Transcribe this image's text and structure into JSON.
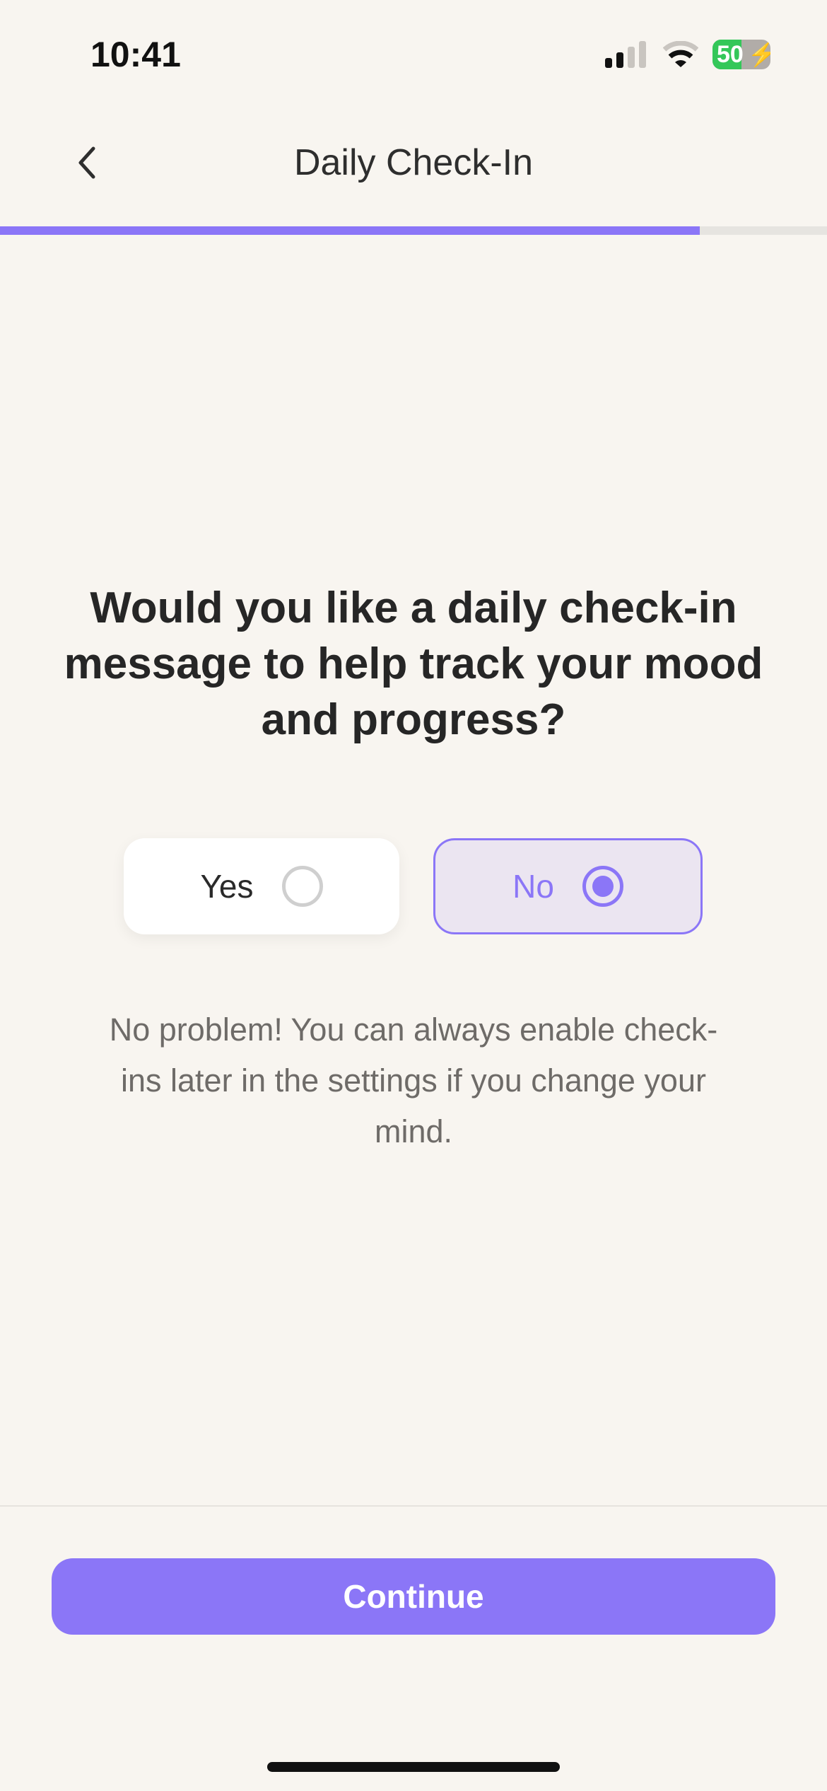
{
  "status_bar": {
    "time": "10:41",
    "battery": "50",
    "battery_level": 0.5,
    "battery_color": "#34c759"
  },
  "header": {
    "title": "Daily Check-In",
    "back_icon": "chevron-left-icon"
  },
  "progress": {
    "value": 0.846,
    "color": "#8b76f7"
  },
  "question": "Would you like a daily check-in message to help track your mood and progress?",
  "options": [
    {
      "label": "Yes",
      "selected": false
    },
    {
      "label": "No",
      "selected": true
    }
  ],
  "helper_text": "No problem! You can always enable check-ins later in the settings if you change your mind.",
  "continue_label": "Continue",
  "accent_color": "#8b76f7"
}
